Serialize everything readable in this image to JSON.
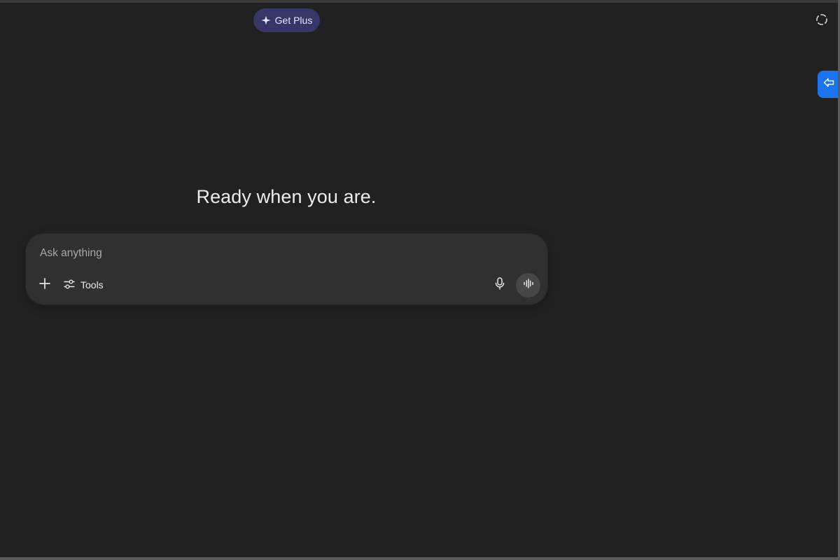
{
  "header": {
    "get_plus_label": "Get Plus"
  },
  "main": {
    "headline": "Ready when you are."
  },
  "composer": {
    "placeholder": "Ask anything",
    "value": "",
    "tools_label": "Tools"
  },
  "colors": {
    "background": "#212121",
    "composer": "#303030",
    "get_plus_bg": "#373669",
    "side_tab": "#1a73f0"
  },
  "icons": {
    "get_plus": "sparkle-icon",
    "temp_chat": "dashed-circle-icon",
    "side_tab": "arrow-left-icon",
    "plus": "plus-icon",
    "tools": "sliders-icon",
    "mic": "microphone-icon",
    "voice": "waveform-icon"
  }
}
